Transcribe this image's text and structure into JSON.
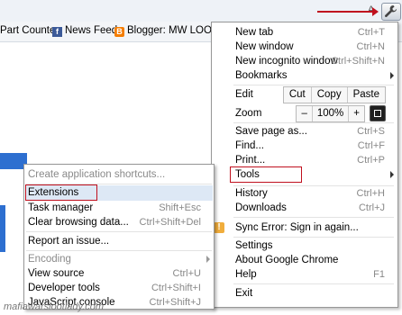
{
  "bookmarks": [
    {
      "label": "Part Counter",
      "icon": "none"
    },
    {
      "label": "News Feeds",
      "icon": "facebook-icon"
    },
    {
      "label": "Blogger: MW LOOT...",
      "icon": "blogger-icon"
    }
  ],
  "toolbar": {
    "letter": "A"
  },
  "menu": {
    "new_tab": {
      "label": "New tab",
      "shortcut": "Ctrl+T"
    },
    "new_window": {
      "label": "New window",
      "shortcut": "Ctrl+N"
    },
    "new_incognito": {
      "label": "New incognito window",
      "shortcut": "Ctrl+Shift+N"
    },
    "bookmarks": {
      "label": "Bookmarks"
    },
    "edit": {
      "label": "Edit",
      "cut": "Cut",
      "copy": "Copy",
      "paste": "Paste"
    },
    "zoom": {
      "label": "Zoom",
      "minus": "–",
      "level": "100%",
      "plus": "+"
    },
    "save_page": {
      "label": "Save page as...",
      "shortcut": "Ctrl+S"
    },
    "find": {
      "label": "Find...",
      "shortcut": "Ctrl+F"
    },
    "print": {
      "label": "Print...",
      "shortcut": "Ctrl+P"
    },
    "tools": {
      "label": "Tools"
    },
    "history": {
      "label": "History",
      "shortcut": "Ctrl+H"
    },
    "downloads": {
      "label": "Downloads",
      "shortcut": "Ctrl+J"
    },
    "sync_error": {
      "label": "Sync Error: Sign in again..."
    },
    "settings": {
      "label": "Settings"
    },
    "about": {
      "label": "About Google Chrome"
    },
    "help": {
      "label": "Help",
      "shortcut": "F1"
    },
    "exit": {
      "label": "Exit"
    }
  },
  "tools_menu": {
    "create_shortcuts": {
      "label": "Create application shortcuts..."
    },
    "extensions": {
      "label": "Extensions"
    },
    "task_manager": {
      "label": "Task manager",
      "shortcut": "Shift+Esc"
    },
    "clear_data": {
      "label": "Clear browsing data...",
      "shortcut": "Ctrl+Shift+Del"
    },
    "report_issue": {
      "label": "Report an issue..."
    },
    "encoding": {
      "label": "Encoding"
    },
    "view_source": {
      "label": "View source",
      "shortcut": "Ctrl+U"
    },
    "dev_tools": {
      "label": "Developer tools",
      "shortcut": "Ctrl+Shift+I"
    },
    "js_console": {
      "label": "JavaScript console",
      "shortcut": "Ctrl+Shift+J"
    }
  },
  "watermark": "mafiawarslootlady.com",
  "colors": {
    "highlight": "#c0101e",
    "submenu_hover": "#dde8f5"
  }
}
